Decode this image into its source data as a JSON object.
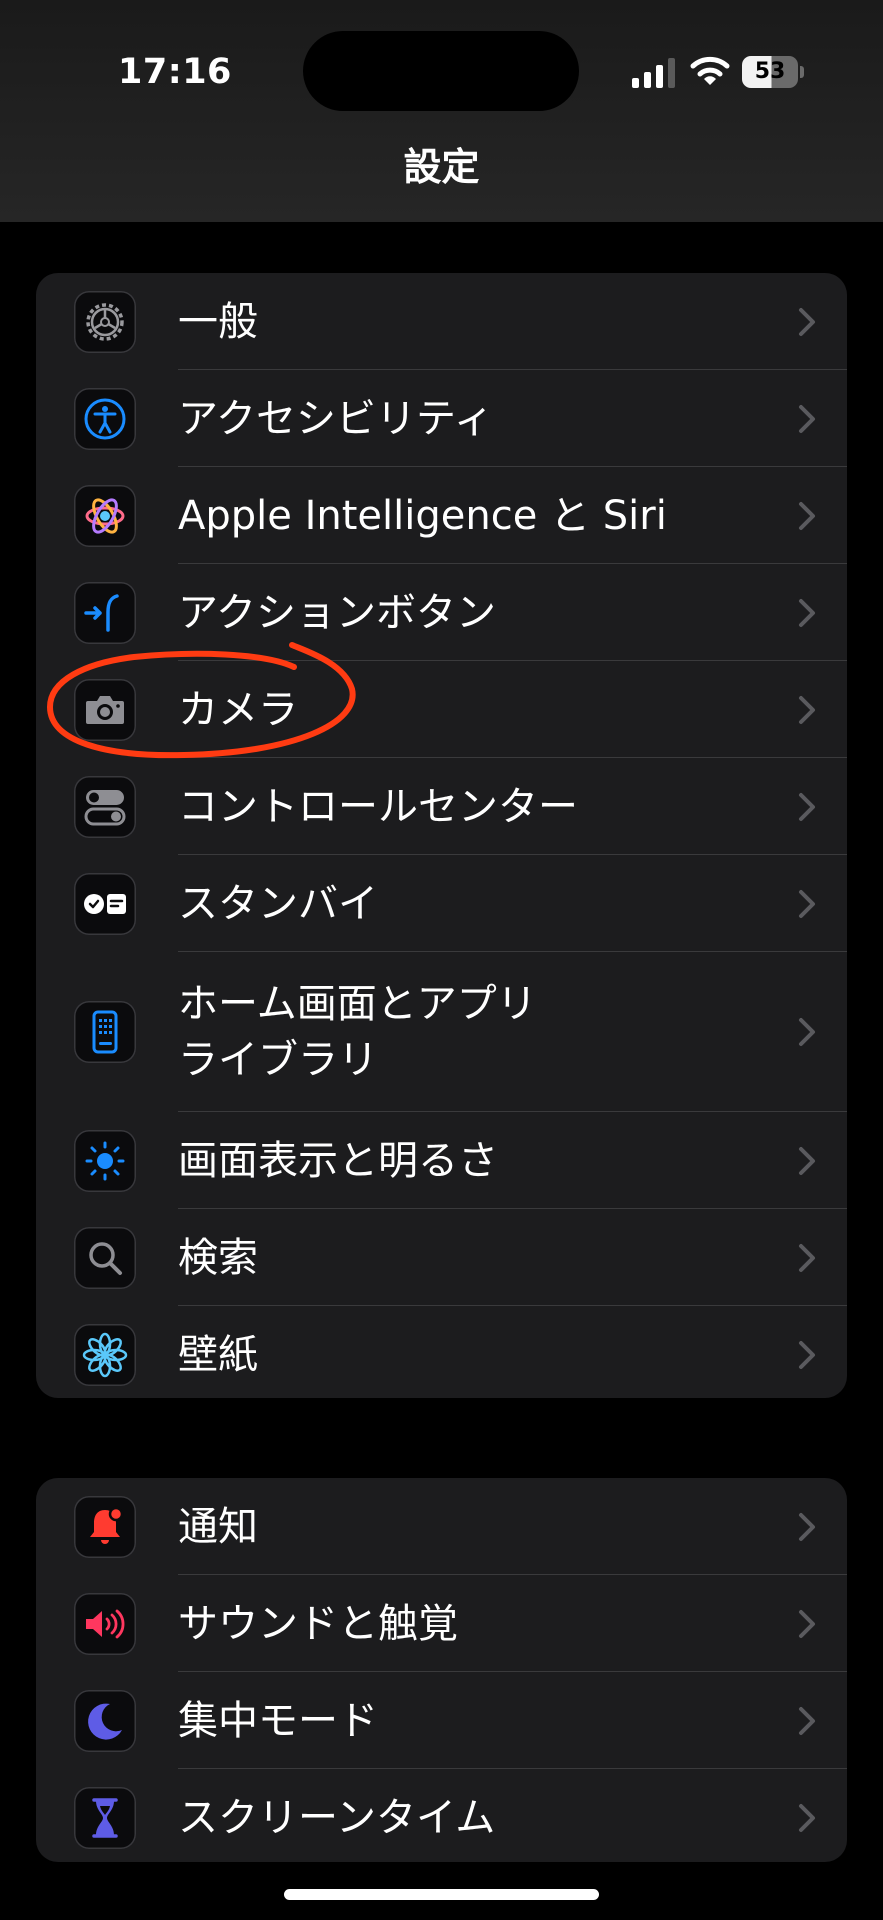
{
  "status_bar": {
    "time": "17:16",
    "battery": "53"
  },
  "nav": {
    "title": "設定"
  },
  "groups": [
    {
      "items": [
        {
          "label": "一般",
          "icon": "gear-icon"
        },
        {
          "label": "アクセシビリティ",
          "icon": "accessibility-icon"
        },
        {
          "label": "Apple Intelligence と Siri",
          "icon": "apple-intelligence-icon"
        },
        {
          "label": "アクションボタン",
          "icon": "action-button-icon"
        },
        {
          "label": "カメラ",
          "icon": "camera-icon"
        },
        {
          "label": "コントロールセンター",
          "icon": "control-center-icon"
        },
        {
          "label": "スタンバイ",
          "icon": "standby-icon"
        },
        {
          "label_line1": "ホーム画面とアプリ",
          "label_line2": "ライブラリ",
          "icon": "home-screen-icon"
        },
        {
          "label": "画面表示と明るさ",
          "icon": "brightness-icon"
        },
        {
          "label": "検索",
          "icon": "search-icon"
        },
        {
          "label": "壁紙",
          "icon": "wallpaper-flower-icon"
        }
      ]
    },
    {
      "items": [
        {
          "label": "通知",
          "icon": "notification-bell-icon"
        },
        {
          "label": "サウンドと触覚",
          "icon": "speaker-icon"
        },
        {
          "label": "集中モード",
          "icon": "moon-icon"
        },
        {
          "label": "スクリーンタイム",
          "icon": "hourglass-icon"
        }
      ]
    }
  ],
  "colors": {
    "background": "#000000",
    "group_background": "#1c1c1e",
    "separator": "#3a3a3c",
    "chevron": "#5a5a5e",
    "annotation": "#ff3b12",
    "accent_blue": "#1a8cff",
    "notification_red": "#ff3b30",
    "focus_purple": "#5e5ce6"
  }
}
